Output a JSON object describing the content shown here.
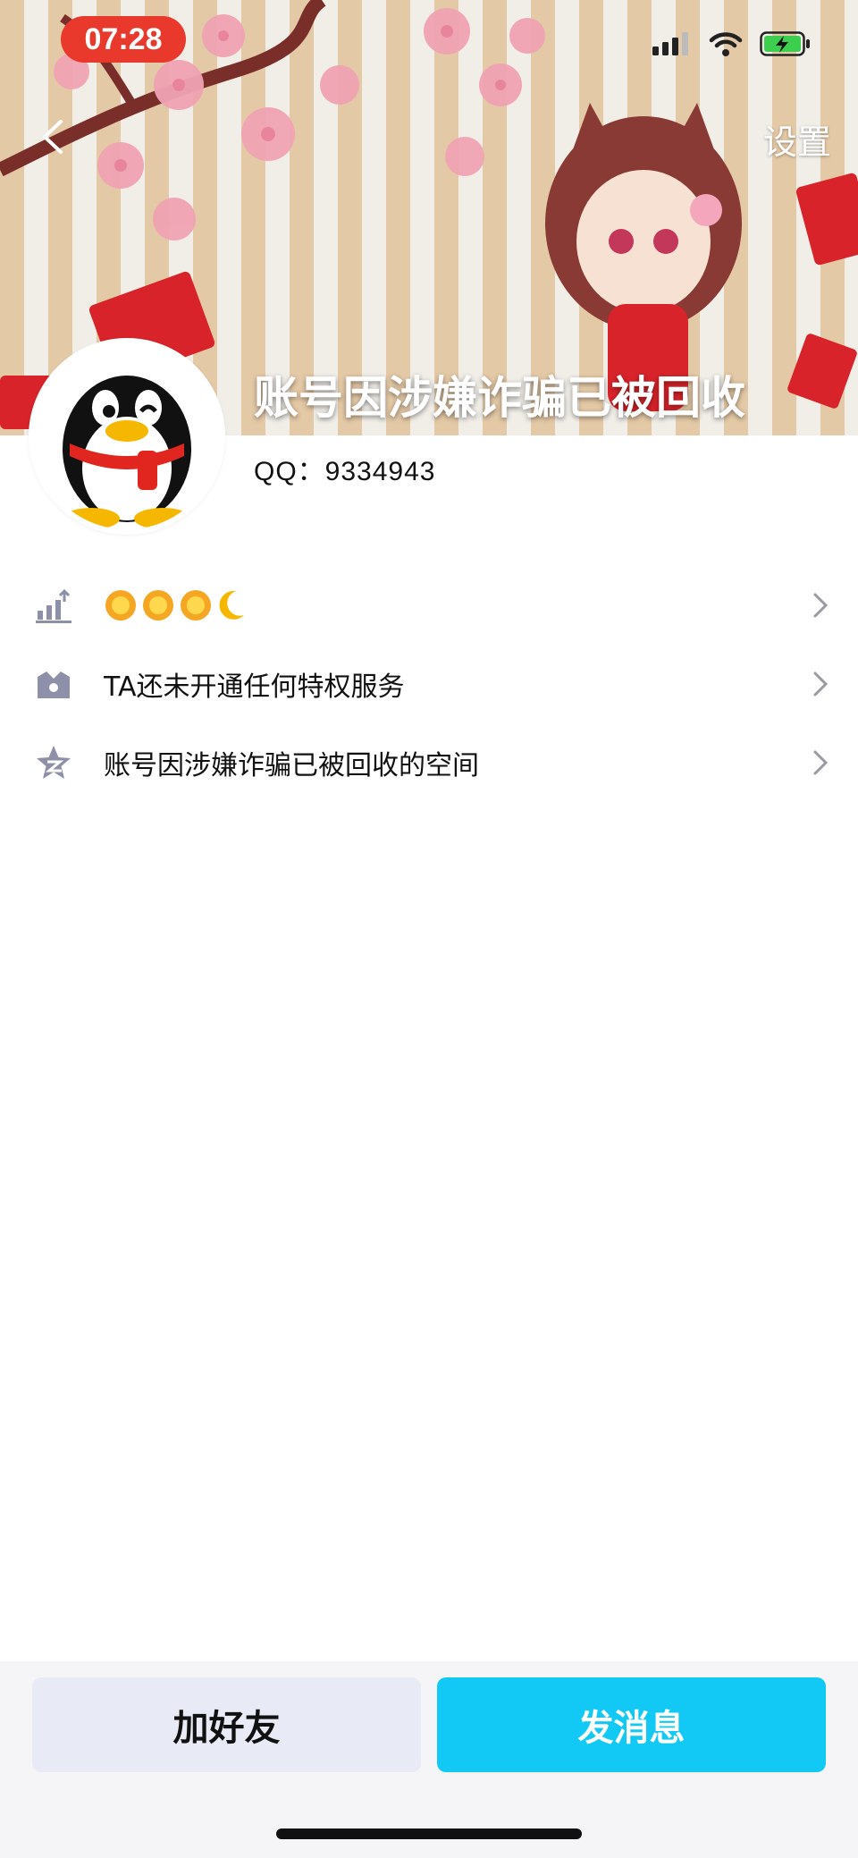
{
  "status_bar": {
    "time": "07:28"
  },
  "header": {
    "settings_label": "设置",
    "nickname": "账号因涉嫌诈骗已被回收"
  },
  "profile": {
    "qq_label": "QQ：9334943"
  },
  "rows": [
    {
      "icon": "level-icon",
      "label": "",
      "level_badges": [
        "sun",
        "sun",
        "sun",
        "moon"
      ]
    },
    {
      "icon": "crown-icon",
      "label": "TA还未开通任何特权服务"
    },
    {
      "icon": "qzone-star-icon",
      "label": "账号因涉嫌诈骗已被回收的空间"
    }
  ],
  "actions": {
    "add_friend": "加好友",
    "send_message": "发消息"
  },
  "colors": {
    "time_badge": "#e8392c",
    "primary_button": "#12c8f5",
    "secondary_button": "#e8ebf5"
  }
}
